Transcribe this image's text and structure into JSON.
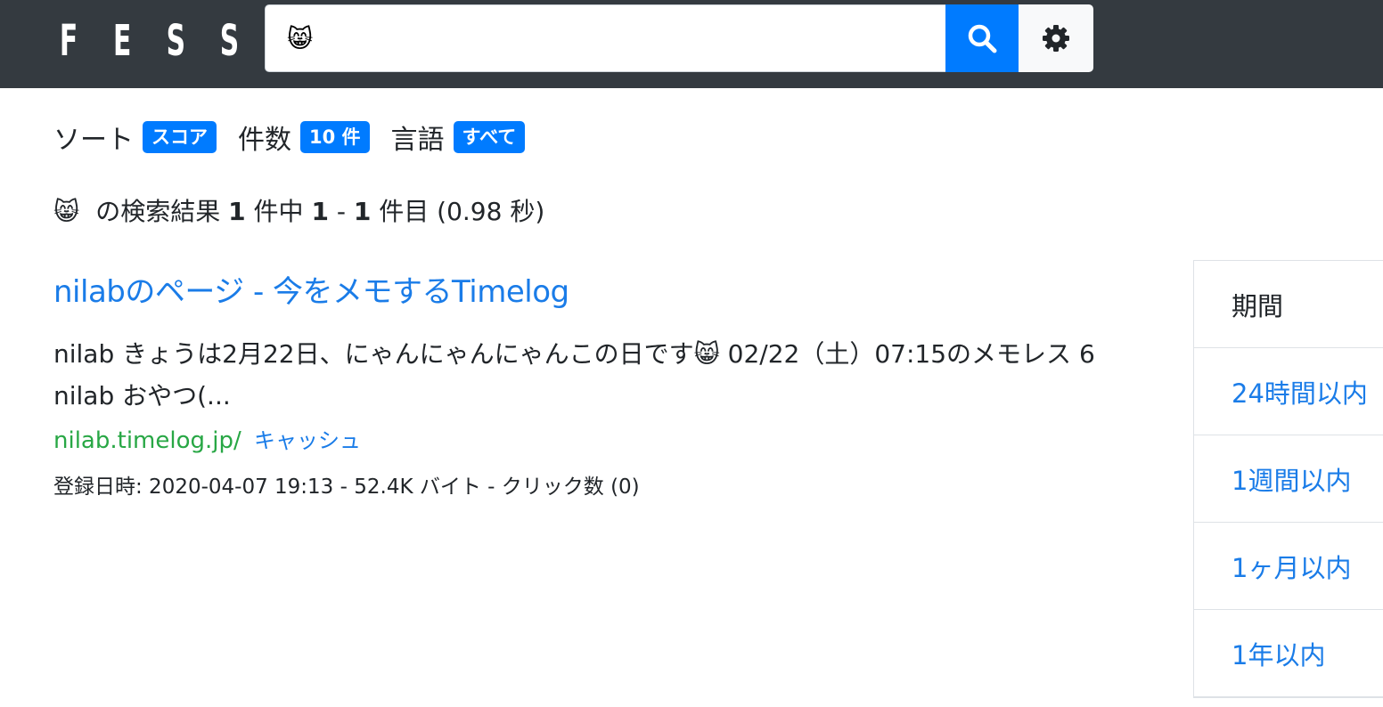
{
  "header": {
    "logo_letters": [
      "F",
      "E",
      "S",
      "S"
    ],
    "search_value": "😸",
    "search_icon": "search-icon",
    "settings_icon": "gear-icon",
    "accent_color": "#007bff",
    "bar_color": "#343a40"
  },
  "options": {
    "sort_label": "ソート",
    "sort_value": "スコア",
    "count_label": "件数",
    "count_value": "10 件",
    "lang_label": "言語",
    "lang_value": "すべて"
  },
  "result_info": {
    "query": "😸",
    "text_before": "の検索結果",
    "total": "1",
    "text_mid": "件中",
    "start": "1",
    "dash": "-",
    "end": "1",
    "text_after": "件目",
    "time": "(0.98 秒)"
  },
  "result": {
    "title": "nilabのページ - 今をメモするTimelog",
    "snippet": "nilab きょうは2月22日、にゃんにゃんにゃんこの日です😸 02/22（土）07:15のメモレス 6 nilab おやつ(...",
    "url": "nilab.timelog.jp/",
    "cache_label": "キャッシュ",
    "meta": "登録日時: 2020-04-07 19:13 - 52.4K バイト - クリック数 (0)"
  },
  "facet": {
    "header": "期間",
    "items": [
      "24時間以内",
      "1週間以内",
      "1ヶ月以内",
      "1年以内"
    ]
  }
}
